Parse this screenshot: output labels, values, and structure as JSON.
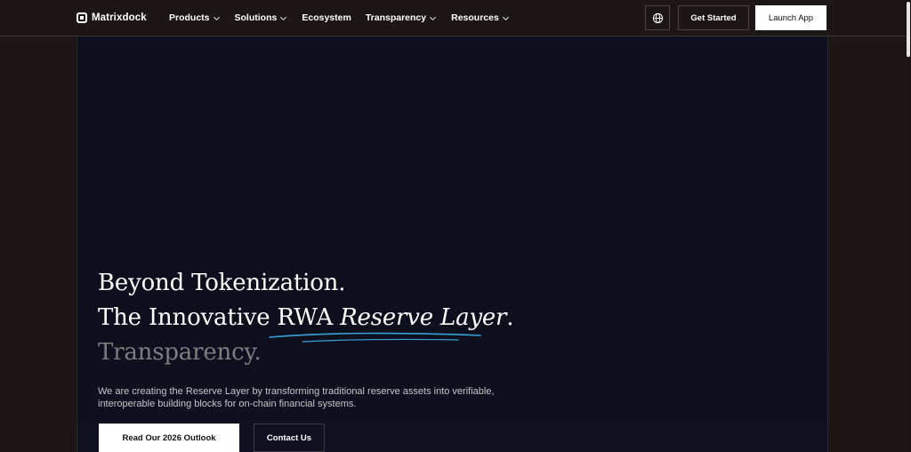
{
  "nav": {
    "brand": "Matrixdock",
    "menu": [
      {
        "label": "Products",
        "has_dropdown": true
      },
      {
        "label": "Solutions",
        "has_dropdown": true
      },
      {
        "label": "Ecosystem",
        "has_dropdown": false
      },
      {
        "label": "Transparency",
        "has_dropdown": true
      },
      {
        "label": "Resources",
        "has_dropdown": true
      }
    ],
    "globe_icon": "globe-icon",
    "get_started": "Get Started",
    "launch_app": "Launch App"
  },
  "hero": {
    "line1": "Beyond Tokenization.",
    "line2_prefix": "The Innovative ",
    "line2_rwa": "RWA ",
    "line2_italic": "Reserve Layer",
    "line2_suffix": ".",
    "line3": "Transparency.",
    "subtext": "We are creating the Reserve Layer by transforming traditional reserve assets into verifiable, interoperable building blocks for on-chain financial systems.",
    "primary_button": "Read Our 2026 Outlook",
    "secondary_button": "Contact Us",
    "accent_color": "#3aa0d8"
  }
}
